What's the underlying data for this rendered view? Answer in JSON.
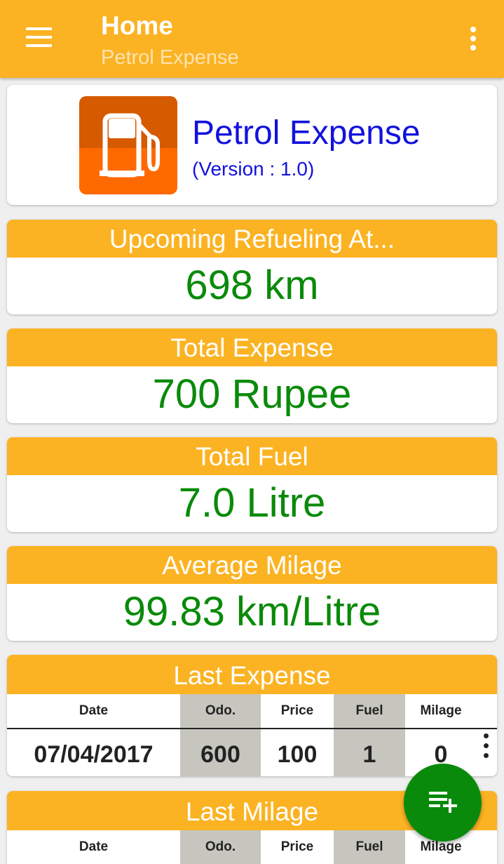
{
  "appbar": {
    "title": "Home",
    "subtitle": "Petrol Expense",
    "menu_icon": "hamburger-menu-icon",
    "more_icon": "more-vert-icon",
    "color": "#fbb323"
  },
  "about": {
    "app_name": "Petrol Expense",
    "version": "(Version : 1.0)",
    "logo_icon": "fuel-pump-icon"
  },
  "stats": {
    "upcoming": {
      "label": "Upcoming Refueling At...",
      "value": "698 km"
    },
    "expense": {
      "label": "Total Expense",
      "value": "700 Rupee"
    },
    "fuel": {
      "label": "Total Fuel",
      "value": "7.0 Litre"
    },
    "milage": {
      "label": "Average Milage",
      "value": "99.83 km/Litre"
    }
  },
  "table_headers": [
    "Date",
    "Odo.",
    "Price",
    "Fuel",
    "Milage"
  ],
  "last_expense": {
    "title": "Last Expense",
    "row": [
      "07/04/2017",
      "600",
      "100",
      "1",
      "0"
    ]
  },
  "last_milage": {
    "title": "Last Milage"
  },
  "fab": {
    "icon": "playlist-add-icon"
  },
  "colors": {
    "accent": "#fbb323",
    "value_green": "#0a8a0a",
    "title_blue": "#1212dd",
    "shaded_column": "#c6c6be"
  }
}
